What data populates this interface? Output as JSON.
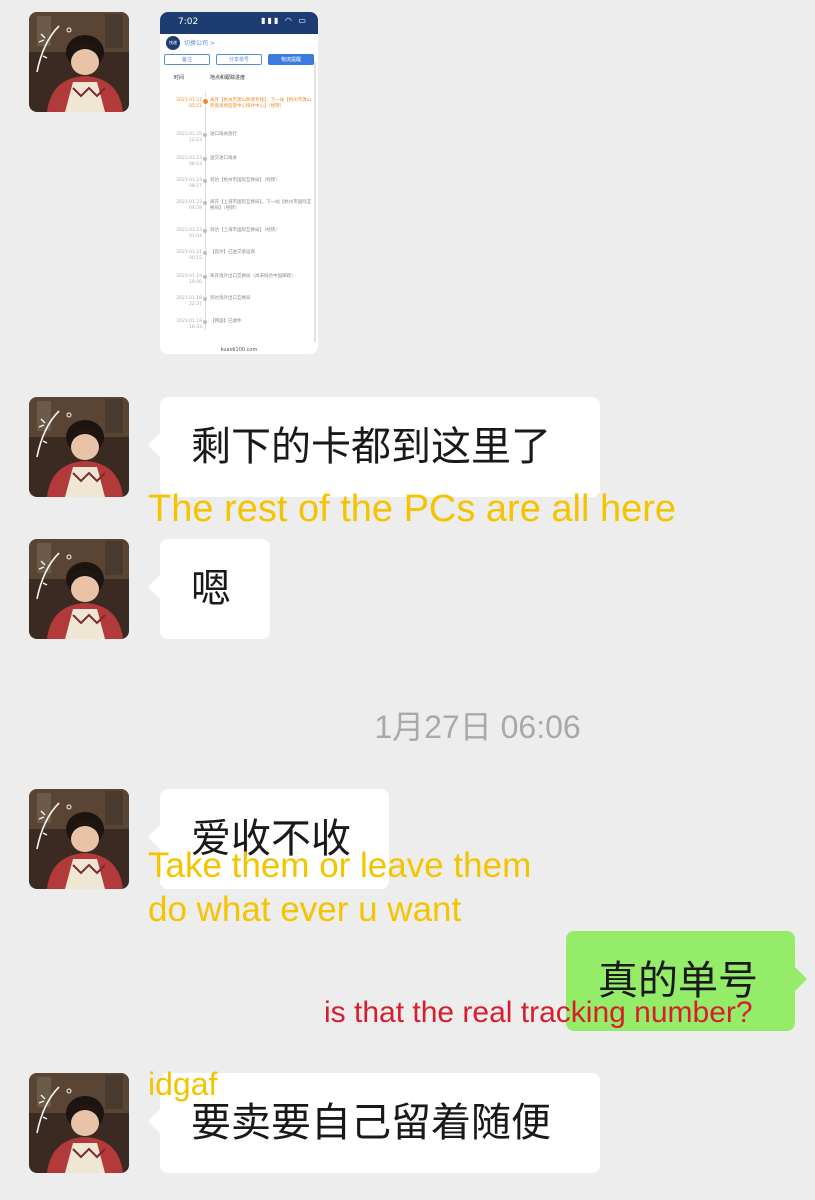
{
  "chat": {
    "screenshot_message": {
      "status_time": "7:02",
      "status_icons": "▮▮▮ ◠ ▭",
      "logo_text": "快递",
      "company_label": "切换公司 >",
      "buttons": [
        "备注",
        "分享单号",
        "物流提醒"
      ],
      "col_time": "时间",
      "col_detail": "地点和跟踪进度",
      "rows": [
        {
          "date": "2023.01.27\n05:51",
          "text": "离开【杭州市萧山跨境专线】，下一站【杭州市萧山跨境现场监管中心快件中心】（经转）",
          "active": true
        },
        {
          "date": "2023.01.25\n12:23",
          "text": "进口海关放行",
          "active": false
        },
        {
          "date": "2023.01.23\n08:53",
          "text": "送交进口海关",
          "active": false
        },
        {
          "date": "2023.01.23\n08:17",
          "text": "到达【杭州市国际互换局】（经转）",
          "active": false
        },
        {
          "date": "2023.01.23\n04:59",
          "text": "离开【上海市国际互换局】，下一站【杭州市国际互换局】（经转）",
          "active": false
        },
        {
          "date": "2023.01.23\n01:04",
          "text": "到达【上海市国际互换局】（经转）",
          "active": false
        },
        {
          "date": "2023.01.21\n00:15",
          "text": "【首尔】已送交承运商",
          "active": false
        },
        {
          "date": "2023.01.19\n10:00",
          "text": "离开境外出口互换局（尚未抵达中国邮政）",
          "active": false
        },
        {
          "date": "2023.01.18\n22:37",
          "text": "到达境外出口互换局",
          "active": false
        },
        {
          "date": "2023.01.18\n16:33",
          "text": "【韩国】已收件",
          "active": false
        }
      ],
      "url": "kuaidi100.com"
    },
    "messages": [
      {
        "text": "剩下的卡都到这里了",
        "translation": "The rest of the PCs are all here"
      },
      {
        "text": "嗯"
      },
      {
        "text": "爱收不收",
        "translation_line1": "Take them or leave them",
        "translation_line2": "do what ever u want"
      },
      {
        "text": "真的单号",
        "translation": "is that the real tracking number?"
      },
      {
        "text": "要卖要自己留着随便",
        "translation": "idgaf"
      }
    ],
    "timestamp": "1月27日 06:06"
  },
  "colors": {
    "background": "#ededed",
    "incoming_bubble": "#ffffff",
    "outgoing_bubble": "#95ec69",
    "translation_yellow": "#f5c400",
    "translation_red": "#d81e2e",
    "timestamp_gray": "#a9a9a9"
  },
  "icons": {
    "avatar": "avatar-photo",
    "status_bar": "signal-wifi-battery-icons"
  }
}
